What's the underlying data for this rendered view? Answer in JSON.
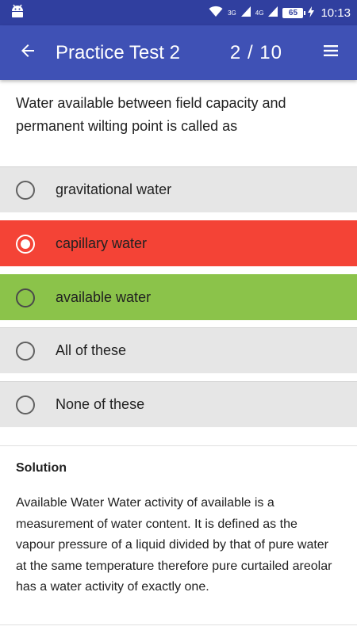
{
  "status_bar": {
    "network_label": "3G",
    "network_label_2": "4G",
    "battery_level": "65",
    "time": "10:13",
    "icons": [
      "android-icon",
      "wifi-icon",
      "signal-icon",
      "signal-icon",
      "charging-icon"
    ]
  },
  "app_bar": {
    "title": "Practice Test 2",
    "current_question": "2",
    "separator": "/",
    "total_questions": "10",
    "back_icon": "arrow-back-icon",
    "menu_icon": "menu-icon",
    "color": "#3f51b5",
    "status_color": "#303f9f"
  },
  "question": {
    "text": "Water available between field capacity and permanent wilting point is called as"
  },
  "options": [
    {
      "label": "gravitational water",
      "state": "neutral"
    },
    {
      "label": "capillary water",
      "state": "wrong",
      "selected": true
    },
    {
      "label": "available water",
      "state": "correct"
    },
    {
      "label": "All of these",
      "state": "neutral"
    },
    {
      "label": "None of these",
      "state": "neutral"
    }
  ],
  "colors": {
    "wrong": "#f44336",
    "correct": "#8bc34a",
    "neutral": "#e6e6e6"
  },
  "solution": {
    "title": "Solution",
    "text": "Available Water Water activity of available is a measurement of water content. It is defined as the vapour pressure of a liquid divided by that of pure water at the same temperature therefore pure curtailed areolar has a water activity of exactly one."
  }
}
